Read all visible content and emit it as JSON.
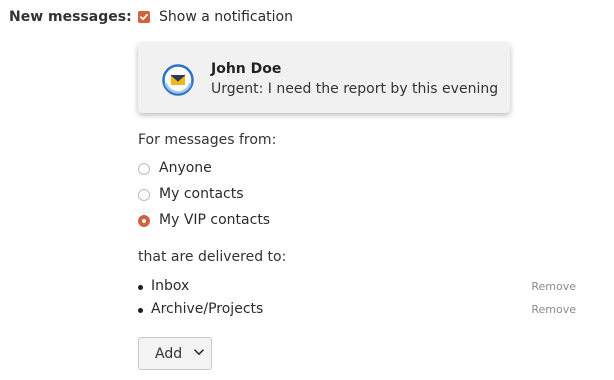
{
  "settings": {
    "row_label": "New messages:",
    "show_notification": {
      "label": "Show a notification",
      "checked": true
    }
  },
  "preview": {
    "icon": "mail-app-icon",
    "sender": "John Doe",
    "message": "Urgent: I need the report by this evening"
  },
  "from": {
    "label": "For messages from:",
    "options": [
      {
        "label": "Anyone",
        "selected": false
      },
      {
        "label": "My contacts",
        "selected": false
      },
      {
        "label": "My VIP contacts",
        "selected": true
      }
    ]
  },
  "delivered": {
    "label": "that are delivered to:",
    "folders": [
      {
        "name": "Inbox",
        "remove_label": "Remove"
      },
      {
        "name": "Archive/Projects",
        "remove_label": "Remove"
      }
    ]
  },
  "add_button": {
    "label": "Add",
    "icon": "chevron-down-icon"
  },
  "colors": {
    "accent": "#d0623d",
    "preview_bg": "#f1f1f1",
    "link_gray": "#8a8a8a"
  }
}
